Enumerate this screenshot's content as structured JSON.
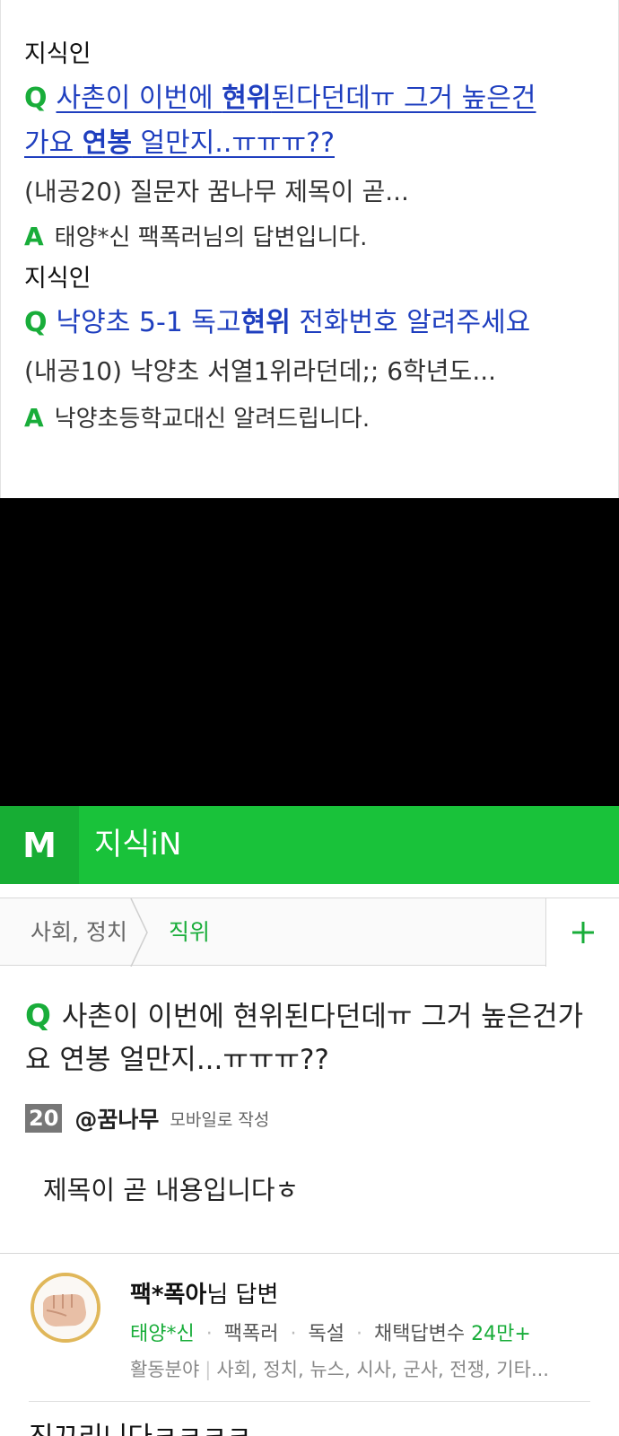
{
  "results": {
    "items": [
      {
        "source": "지식인",
        "q_mark": "Q",
        "title_pre": "사촌이 이번에 ",
        "title_hl": "현위",
        "title_post": "된다던데ㅠ 그거 높은건",
        "title2_pre": "가요 ",
        "title2_hl": "연봉",
        "title2_post": " 얼만지..ㅠㅠㅠ??",
        "snippet": "(내공20) 질문자 꿈나무 제목이 곧...",
        "a_mark": "A",
        "answer": "태양*신 팩폭러님의 답변입니다."
      },
      {
        "source": "지식인",
        "q_mark": "Q",
        "title_pre": "낙양초 5-1 독고",
        "title_hl": "현위",
        "title_post": " 전화번호 알려주세요",
        "snippet": "(내공10) 낙양초 서열1위라던데;; 6학년도...",
        "a_mark": "A",
        "answer": "낙양초등학교대신 알려드립니다."
      }
    ]
  },
  "header": {
    "logo": "M",
    "title": "지식iN"
  },
  "breadcrumb": {
    "category": "사회, 정치",
    "subcategory": "직위",
    "add_label": "+"
  },
  "question": {
    "q_mark": "Q",
    "title": "사촌이 이번에 현위된다던데ㅠ 그거 높은건가요 연봉 얼만지...ㅠㅠㅠ??",
    "bounty": "20",
    "author": "@꿈나무",
    "author_note": "모바일로 작성",
    "body": "제목이 곧 내용입니다ㅎ"
  },
  "answer": {
    "title_name": "팩*폭아",
    "title_suffix": "님 답변",
    "level": "태양*신",
    "sep": "·",
    "tag1": "팩폭러",
    "tag2": "독설",
    "adopt_label": "채택답변수",
    "adopt_count": "24만+",
    "field_label": "활동분야",
    "field_value": "사회, 정치, 뉴스, 시사, 군사, 전쟁, 기타...",
    "body": "진끄리니다ㅋㅋㅋㅋ"
  },
  "colors": {
    "brand_green": "#19c23a",
    "link_blue": "#1f3fbf",
    "badge_gold": "#e0b75a"
  },
  "icons": {
    "add": "plus-icon",
    "separator": "chevron-right-icon",
    "avatar": "fist-avatar"
  }
}
